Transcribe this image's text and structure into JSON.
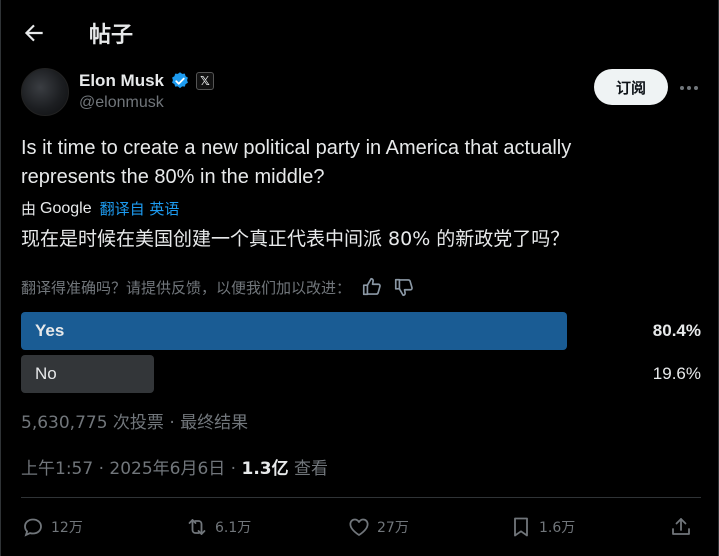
{
  "header": {
    "title": "帖子"
  },
  "author": {
    "name": "Elon Musk",
    "handle": "@elonmusk",
    "badge": "𝕏"
  },
  "subscribe_label": "订阅",
  "post": {
    "text": "Is it time to create a new political party in America that actually represents the 80% in the middle?",
    "translate_by": "由",
    "translate_provider": "Google",
    "translate_from": "翻译自 英语",
    "translated_text": "现在是时候在美国创建一个真正代表中间派 80% 的新政党了吗？"
  },
  "feedback": {
    "prompt": "翻译得准确吗？请提供反馈，以便我们加以改进："
  },
  "poll": {
    "options": [
      {
        "label": "Yes",
        "percent": "80.4%",
        "share": 0.804,
        "color": "#1a5c94"
      },
      {
        "label": "No",
        "percent": "19.6%",
        "share": 0.196,
        "color": "#333639"
      }
    ],
    "summary": "5,630,775 次投票 · 最终结果"
  },
  "meta": {
    "time": "上午1:57 · 2025年6月6日 · ",
    "views_count": "1.3亿",
    "views_label": " 查看"
  },
  "actions": {
    "replies": "12万",
    "reposts": "6.1万",
    "likes": "27万",
    "bookmarks": "1.6万"
  },
  "colors": {
    "accent": "#1d9bf0",
    "background": "#000000",
    "muted": "#71767b"
  }
}
